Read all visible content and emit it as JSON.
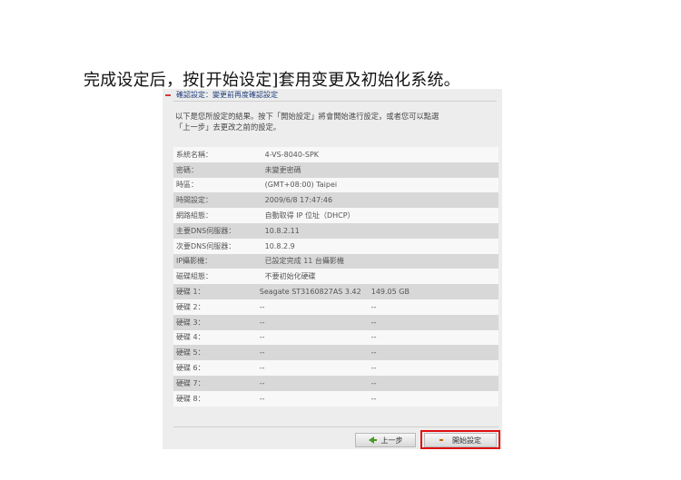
{
  "caption": "完成设定后，按[开始设定]套用变更及初始化系统。",
  "section": {
    "title": "確認設定：變更前再度確認設定"
  },
  "intro": {
    "line1": "以下是您所設定的結果。按下「開始設定」將會開始進行設定，或者您可以點選",
    "line2": "「上一步」去更改之前的設定。"
  },
  "rows": [
    {
      "label": "系統名稱：",
      "value": "4-VS-8040-SPK"
    },
    {
      "label": "密碼：",
      "value": "未變更密碼"
    },
    {
      "label": "時區：",
      "value": "(GMT+08:00) Taipei"
    },
    {
      "label": "時間設定：",
      "value": "2009/6/8 17:47:46"
    },
    {
      "label": "網路組態：",
      "value": "自動取得 IP 位址（DHCP）"
    },
    {
      "label": "主要DNS伺服器：",
      "value": "10.8.2.11"
    },
    {
      "label": "次要DNS伺服器：",
      "value": "10.8.2.9"
    },
    {
      "label": "IP攝影機：",
      "value": "已設定完成 11 台攝影機"
    },
    {
      "label": "磁碟組態：",
      "value": "不要初始化硬碟"
    }
  ],
  "disks": [
    {
      "label": "硬碟 1：",
      "model": "Seagate ST3160827AS 3.42",
      "size": "149.05 GB"
    },
    {
      "label": "硬碟 2：",
      "model": "--",
      "size": "--"
    },
    {
      "label": "硬碟 3：",
      "model": "--",
      "size": "--"
    },
    {
      "label": "硬碟 4：",
      "model": "--",
      "size": "--"
    },
    {
      "label": "硬碟 5：",
      "model": "--",
      "size": "--"
    },
    {
      "label": "硬碟 6：",
      "model": "--",
      "size": "--"
    },
    {
      "label": "硬碟 7：",
      "model": "--",
      "size": "--"
    },
    {
      "label": "硬碟 8：",
      "model": "--",
      "size": "--"
    }
  ],
  "buttons": {
    "prev": "上一步",
    "start": "開始設定"
  },
  "colors": {
    "highlight": "#e01010",
    "title": "#1e3e7c",
    "prev_arrow": "#4a9a2a"
  }
}
